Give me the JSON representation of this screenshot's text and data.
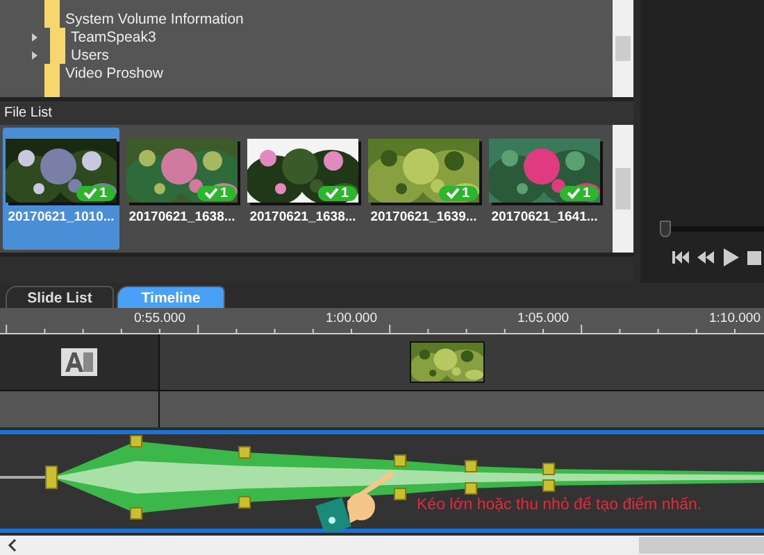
{
  "folder_tree": {
    "items": [
      {
        "label": "System Volume Information",
        "has_children": false
      },
      {
        "label": "TeamSpeak3",
        "has_children": true
      },
      {
        "label": "Users",
        "has_children": true
      },
      {
        "label": "Video Proshow",
        "has_children": false
      }
    ]
  },
  "file_list": {
    "title": "File List",
    "items": [
      {
        "label": "20170621_1010...",
        "badge": "1",
        "selected": true,
        "kind": "picture"
      },
      {
        "label": "20170621_1638...",
        "badge": "1",
        "selected": false,
        "kind": "picture"
      },
      {
        "label": "20170621_1638...",
        "badge": "1",
        "selected": false,
        "kind": "picture"
      },
      {
        "label": "20170621_1639...",
        "badge": "1",
        "selected": false,
        "kind": "picture"
      },
      {
        "label": "20170621_1641...",
        "badge": "1",
        "selected": false,
        "kind": "picture"
      }
    ]
  },
  "preview": {
    "position": {
      "level": 0
    }
  },
  "tabs": [
    {
      "label": "Slide List",
      "selected": false
    },
    {
      "label": "Timeline",
      "selected": true
    }
  ],
  "ruler": {
    "marks": [
      "0:55.000",
      "1:00.000",
      "1:05.000",
      "1:10.000"
    ]
  },
  "hint": "Kéo lớn hoặc thu nhỏ để tạo điểm nhấn."
}
